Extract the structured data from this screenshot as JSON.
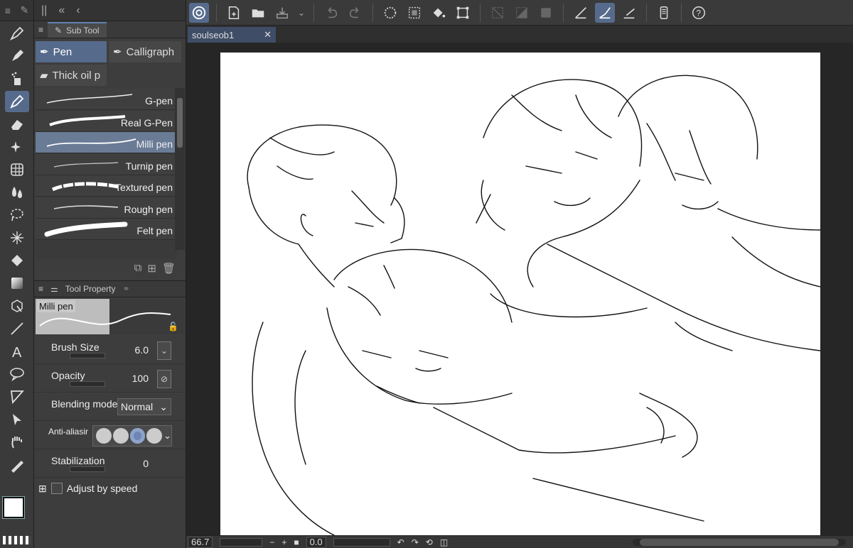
{
  "subtool_panel": {
    "title": "Sub Tool",
    "groups": [
      "Pen",
      "Calligraph",
      "Thick oil p"
    ],
    "brushes": [
      "G-pen",
      "Real G-Pen",
      "Milli pen",
      "Turnip pen",
      "Textured pen",
      "Rough pen",
      "Felt pen"
    ],
    "selected_brush": "Milli pen"
  },
  "tool_property": {
    "title": "Tool Property",
    "preview_label": "Milli pen",
    "brush_size_label": "Brush Size",
    "brush_size_value": "6.0",
    "opacity_label": "Opacity",
    "opacity_value": "100",
    "blending_label": "Blending mode",
    "blending_value": "Normal",
    "antialias_label": "Anti-aliasir",
    "stabilization_label": "Stabilization",
    "stabilization_value": "0",
    "adjust_label": "Adjust by speed"
  },
  "document": {
    "tab_name": "soulseob1",
    "close_symbol": "✕"
  },
  "status": {
    "zoom": "66.7",
    "angle": "0.0"
  },
  "colors": {
    "accent": "#566b8c",
    "panel": "#3d3d3d",
    "canvas_bg": "#262626"
  },
  "icons": {
    "left_tools": [
      "pen-nib-icon",
      "marker-icon",
      "airbrush-icon",
      "pen-icon",
      "eraser-icon",
      "sparkle-icon",
      "grid-icon",
      "blend-icon",
      "lasso-icon",
      "auto-select-icon",
      "fill-icon",
      "gradient-icon",
      "object-select-icon",
      "line-icon",
      "text-icon",
      "balloon-icon",
      "frame-icon",
      "operation-icon",
      "hand-icon",
      "eyedropper-icon"
    ]
  }
}
